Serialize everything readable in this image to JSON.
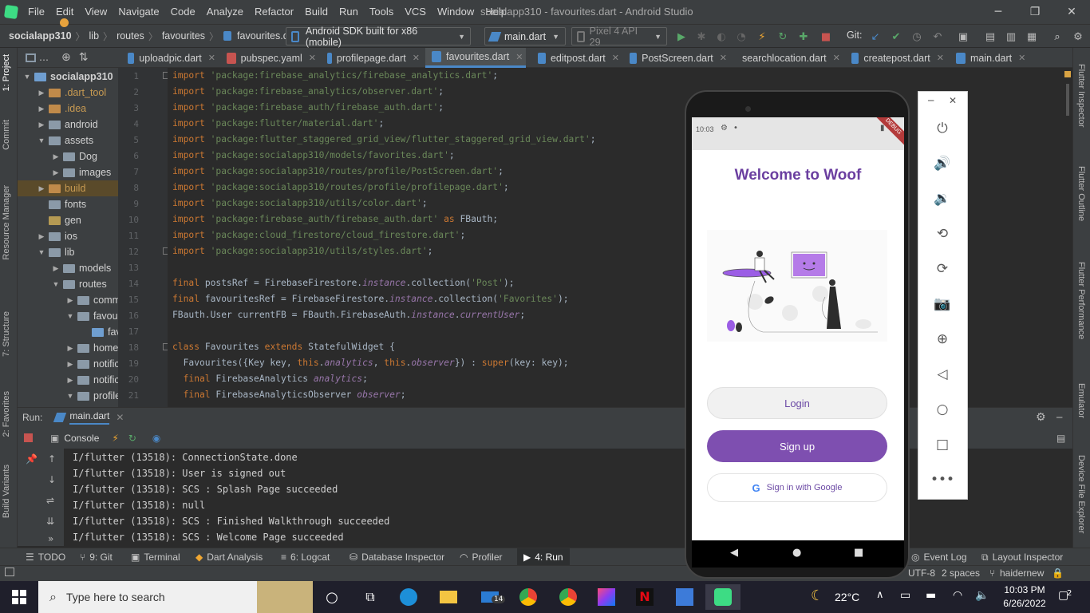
{
  "window": {
    "title": "socialapp310 - favourites.dart - Android Studio",
    "minimize": "─",
    "restore": "❐",
    "close": "✕"
  },
  "menu": [
    "File",
    "Edit",
    "View",
    "Navigate",
    "Code",
    "Analyze",
    "Refactor",
    "Build",
    "Run",
    "Tools",
    "VCS",
    "Window",
    "Help"
  ],
  "breadcrumb": [
    "socialapp310",
    "lib",
    "routes",
    "favourites",
    "favourites.dart"
  ],
  "toolbar": {
    "device_combo": "Android SDK built for x86 (mobile)",
    "run_config": "main.dart",
    "avd": "Pixel 4 API 29",
    "git_label": "Git:"
  },
  "left_strip": [
    "1: Project",
    "Commit",
    "Resource Manager",
    "7: Structure",
    "2: Favorites",
    "Build Variants"
  ],
  "right_strip": [
    "Flutter Inspector",
    "Flutter Outline",
    "Flutter Performance",
    "Emulator",
    "Device File Explorer"
  ],
  "tree": [
    {
      "label": "socialapp310",
      "indent": 0,
      "arrow": "▼",
      "icon": "blue",
      "bold": true,
      "suffix": "C"
    },
    {
      "label": ".dart_tool",
      "indent": 1,
      "arrow": "▶",
      "icon": "orange",
      "color": "#c79a52"
    },
    {
      "label": ".idea",
      "indent": 1,
      "arrow": "▶",
      "icon": "orange",
      "color": "#c79a52"
    },
    {
      "label": "android",
      "indent": 1,
      "arrow": "▶",
      "icon": "gray"
    },
    {
      "label": "assets",
      "indent": 1,
      "arrow": "▼",
      "icon": "gray"
    },
    {
      "label": "Dog",
      "indent": 2,
      "arrow": "▶",
      "icon": "gray"
    },
    {
      "label": "images",
      "indent": 2,
      "arrow": "▶",
      "icon": "gray"
    },
    {
      "label": "build",
      "indent": 1,
      "arrow": "▶",
      "icon": "orange",
      "color": "#c79a52",
      "highlight": true
    },
    {
      "label": "fonts",
      "indent": 1,
      "arrow": "",
      "icon": "gray"
    },
    {
      "label": "gen",
      "indent": 1,
      "arrow": "",
      "icon": "ylw"
    },
    {
      "label": "ios",
      "indent": 1,
      "arrow": "▶",
      "icon": "gray"
    },
    {
      "label": "lib",
      "indent": 1,
      "arrow": "▼",
      "icon": "gray"
    },
    {
      "label": "models",
      "indent": 2,
      "arrow": "▶",
      "icon": "gray"
    },
    {
      "label": "routes",
      "indent": 2,
      "arrow": "▼",
      "icon": "gray"
    },
    {
      "label": "comm",
      "indent": 3,
      "arrow": "▶",
      "icon": "gray"
    },
    {
      "label": "favour",
      "indent": 3,
      "arrow": "▼",
      "icon": "gray"
    },
    {
      "label": "fav",
      "indent": 4,
      "arrow": "",
      "icon": "blue"
    },
    {
      "label": "home",
      "indent": 3,
      "arrow": "▶",
      "icon": "gray"
    },
    {
      "label": "notific",
      "indent": 3,
      "arrow": "▶",
      "icon": "gray"
    },
    {
      "label": "notific",
      "indent": 3,
      "arrow": "▶",
      "icon": "gray"
    },
    {
      "label": "profile",
      "indent": 3,
      "arrow": "▼",
      "icon": "gray"
    }
  ],
  "tabs": [
    {
      "label": "uploadpic.dart",
      "color": "#4a88c7"
    },
    {
      "label": "pubspec.yaml",
      "color": "#c75450"
    },
    {
      "label": "profilepage.dart",
      "color": "#4a88c7"
    },
    {
      "label": "favourites.dart",
      "color": "#4a88c7",
      "active": true
    },
    {
      "label": "editpost.dart",
      "color": "#4a88c7"
    },
    {
      "label": "PostScreen.dart",
      "color": "#4a88c7"
    },
    {
      "label": "searchlocation.dart",
      "color": "#4a88c7"
    },
    {
      "label": "createpost.dart",
      "color": "#4a88c7"
    },
    {
      "label": "main.dart",
      "color": "#4a88c7"
    }
  ],
  "code": [
    [
      [
        "kw",
        "import "
      ],
      [
        "str",
        "'package:firebase_analytics/firebase_analytics.dart'"
      ],
      [
        "pl",
        ";"
      ]
    ],
    [
      [
        "kw",
        "import "
      ],
      [
        "str",
        "'package:firebase_analytics/observer.dart'"
      ],
      [
        "pl",
        ";"
      ]
    ],
    [
      [
        "kw",
        "import "
      ],
      [
        "str",
        "'package:firebase_auth/firebase_auth.dart'"
      ],
      [
        "pl",
        ";"
      ]
    ],
    [
      [
        "kw",
        "import "
      ],
      [
        "str",
        "'package:flutter/material.dart'"
      ],
      [
        "pl",
        ";"
      ]
    ],
    [
      [
        "kw",
        "import "
      ],
      [
        "str",
        "'package:flutter_staggered_grid_view/flutter_staggered_grid_view.dart'"
      ],
      [
        "pl",
        ";"
      ]
    ],
    [
      [
        "kw",
        "import "
      ],
      [
        "str",
        "'package:socialapp310/models/favorites.dart'"
      ],
      [
        "pl",
        ";"
      ]
    ],
    [
      [
        "kw",
        "import "
      ],
      [
        "str",
        "'package:socialapp310/routes/profile/PostScreen.dart'"
      ],
      [
        "pl",
        ";"
      ]
    ],
    [
      [
        "kw",
        "import "
      ],
      [
        "str",
        "'package:socialapp310/routes/profile/profilepage.dart'"
      ],
      [
        "pl",
        ";"
      ]
    ],
    [
      [
        "kw",
        "import "
      ],
      [
        "str",
        "'package:socialapp310/utils/color.dart'"
      ],
      [
        "pl",
        ";"
      ]
    ],
    [
      [
        "kw",
        "import "
      ],
      [
        "str",
        "'package:firebase_auth/firebase_auth.dart' "
      ],
      [
        "kw",
        "as "
      ],
      [
        "pl",
        "FBauth;"
      ]
    ],
    [
      [
        "kw",
        "import "
      ],
      [
        "str",
        "'package:cloud_firestore/cloud_firestore.dart'"
      ],
      [
        "pl",
        ";"
      ]
    ],
    [
      [
        "kw",
        "import "
      ],
      [
        "str",
        "'package:socialapp310/utils/styles.dart'"
      ],
      [
        "pl",
        ";"
      ]
    ],
    [],
    [
      [
        "kw",
        "final "
      ],
      [
        "pl",
        "postsRef = FirebaseFirestore."
      ],
      [
        "it",
        "instance"
      ],
      [
        "pl",
        ".collection("
      ],
      [
        "str",
        "'Post'"
      ],
      [
        "pl",
        ");"
      ]
    ],
    [
      [
        "kw",
        "final "
      ],
      [
        "pl",
        "favouritesRef = FirebaseFirestore."
      ],
      [
        "it",
        "instance"
      ],
      [
        "pl",
        ".collection("
      ],
      [
        "str",
        "'Favorites'"
      ],
      [
        "pl",
        ");"
      ]
    ],
    [
      [
        "pl",
        "FBauth.User currentFB = FBauth.FirebaseAuth."
      ],
      [
        "it",
        "instance"
      ],
      [
        "pl",
        "."
      ],
      [
        "it",
        "currentUser"
      ],
      [
        "pl",
        ";"
      ]
    ],
    [],
    [
      [
        "kw",
        "class "
      ],
      [
        "pl",
        "Favourites "
      ],
      [
        "kw",
        "extends "
      ],
      [
        "pl",
        "StatefulWidget {"
      ]
    ],
    [
      [
        "pl",
        "  Favourites({Key key, "
      ],
      [
        "kw",
        "this"
      ],
      [
        "pl",
        "."
      ],
      [
        "it",
        "analytics"
      ],
      [
        "pl",
        ", "
      ],
      [
        "kw",
        "this"
      ],
      [
        "pl",
        "."
      ],
      [
        "it",
        "observer"
      ],
      [
        "pl",
        "}) : "
      ],
      [
        "kw",
        "super"
      ],
      [
        "pl",
        "(key: key);"
      ]
    ],
    [
      [
        "kw",
        "  final "
      ],
      [
        "pl",
        "FirebaseAnalytics "
      ],
      [
        "it",
        "analytics"
      ],
      [
        "pl",
        ";"
      ]
    ],
    [
      [
        "kw",
        "  final "
      ],
      [
        "pl",
        "FirebaseAnalyticsObserver "
      ],
      [
        "it",
        "observer"
      ],
      [
        "pl",
        ";"
      ]
    ]
  ],
  "run": {
    "label": "Run:",
    "tab": "main.dart",
    "console": "Console"
  },
  "console_lines": [
    "I/flutter (13518): ConnectionState.done",
    "I/flutter (13518): User is signed out",
    "I/flutter (13518): SCS : Splash Page succeeded",
    "I/flutter (13518): null",
    "I/flutter (13518): SCS : Finished Walkthrough succeeded",
    "I/flutter (13518): SCS : Welcome Page succeeded"
  ],
  "bottom_tools": [
    "TODO",
    "9: Git",
    "Terminal",
    "Dart Analysis",
    "6: Logcat",
    "Database Inspector",
    "Profiler",
    "4: Run"
  ],
  "bottom_right_tools": [
    "Event Log",
    "Layout Inspector"
  ],
  "status": {
    "encoding": "UTF-8",
    "indent": "2 spaces",
    "branch": "haidernew"
  },
  "phone": {
    "time": "10:03",
    "title": "Welcome to Woof",
    "login": "Login",
    "signup": "Sign up",
    "google": "Sign in with Google",
    "debug": "DEBUG"
  },
  "taskbar": {
    "search_placeholder": "Type here to search",
    "temperature": "22°C",
    "time": "10:03 PM",
    "date": "6/26/2022",
    "mail_badge": "14",
    "notif_count": "2"
  },
  "colors": {
    "accent": "#7e4fb0",
    "editor_bg": "#2b2b2b",
    "chrome": "#3c3f41"
  }
}
